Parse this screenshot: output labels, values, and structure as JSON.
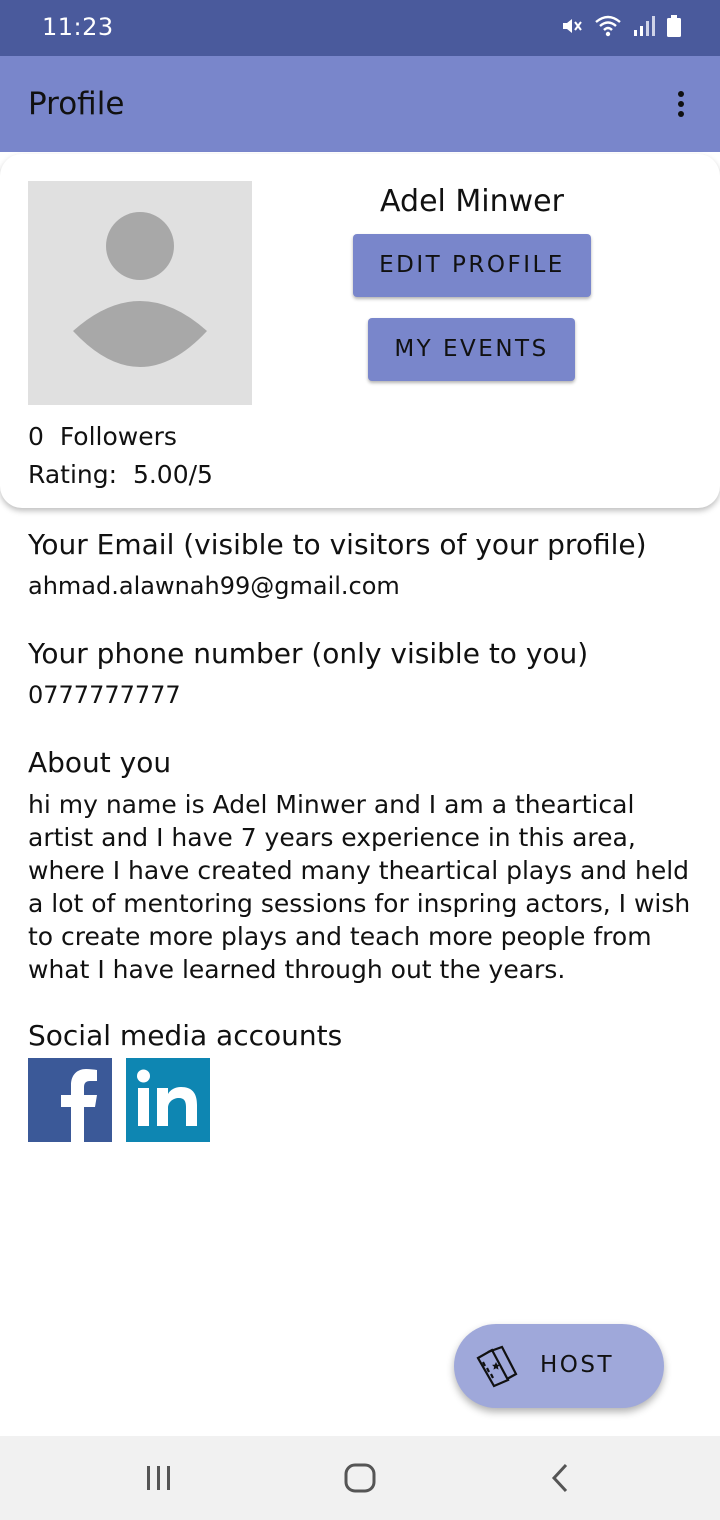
{
  "status_bar": {
    "time": "11:23",
    "icons": [
      "mute-icon",
      "wifi-icon",
      "signal-icon",
      "battery-icon"
    ]
  },
  "app_bar": {
    "title": "Profile",
    "overflow_icon": "more-vert-icon"
  },
  "profile": {
    "name": "Adel Minwer",
    "edit_profile_label": "EDIT PROFILE",
    "my_events_label": "MY EVENTS",
    "followers_count": "0",
    "followers_label": "Followers",
    "rating_label": "Rating:",
    "rating_value": "5.00/5"
  },
  "email": {
    "label": "Your Email (visible to visitors of your profile)",
    "value": "ahmad.alawnah99@gmail.com"
  },
  "phone": {
    "label": "Your phone number (only visible to you)",
    "value": "0777777777"
  },
  "about": {
    "label": "About you",
    "text": "hi my name is Adel Minwer and I am a theartical artist and I have 7 years experience in this area, where I have created many theartical plays and held a lot of mentoring sessions for inspring actors, I wish to create more plays and teach more people from what I have learned through out the years."
  },
  "social": {
    "label": "Social media accounts",
    "facebook_text": "f",
    "linkedin_text": "in"
  },
  "fab": {
    "label": "HOST",
    "icon": "ticket-icon"
  },
  "colors": {
    "status_bar": "#4a5a9c",
    "app_bar": "#7986cb",
    "button": "#7986cb",
    "fab": "#9fa8da",
    "facebook": "#3b5998",
    "linkedin": "#0e86b2",
    "avatar_bg": "#e0e0e0",
    "avatar_fg": "#a8a8a8"
  }
}
